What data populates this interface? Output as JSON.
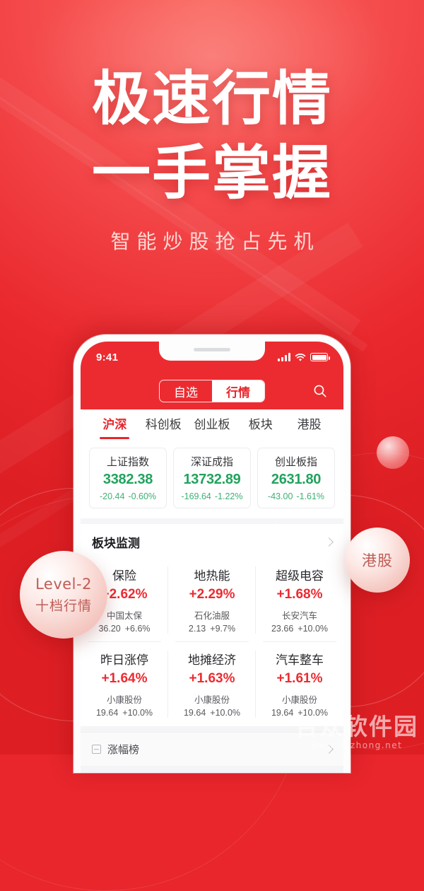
{
  "hero": {
    "line1": "极速行情",
    "line2": "一手掌握",
    "subtitle": "智能炒股抢占先机"
  },
  "badges": {
    "left": {
      "line1": "Level-2",
      "line2": "十档行情"
    },
    "right": {
      "label": "港股"
    }
  },
  "phone": {
    "statusbar": {
      "time": "9:41"
    },
    "navbar": {
      "segments": [
        {
          "label": "自选",
          "active": false
        },
        {
          "label": "行情",
          "active": true
        }
      ],
      "search_icon": "search-icon"
    },
    "tabs": [
      {
        "label": "沪深",
        "active": true
      },
      {
        "label": "科创板",
        "active": false
      },
      {
        "label": "创业板",
        "active": false
      },
      {
        "label": "板块",
        "active": false
      },
      {
        "label": "港股",
        "active": false
      }
    ],
    "indices": [
      {
        "name": "上证指数",
        "value": "3382.38",
        "change": "-20.44",
        "percent": "-0.60%"
      },
      {
        "name": "深证成指",
        "value": "13732.89",
        "change": "-169.64",
        "percent": "-1.22%"
      },
      {
        "name": "创业板指",
        "value": "2631.80",
        "change": "-43.00",
        "percent": "-1.61%"
      }
    ],
    "sector_panel": {
      "title": "板块监测",
      "more_icon": "chevron-right-icon",
      "cells": [
        {
          "sector": "保险",
          "percent": "+2.62%",
          "stock": "中国太保",
          "price": "36.20",
          "stock_percent": "+6.6%"
        },
        {
          "sector": "地热能",
          "percent": "+2.29%",
          "stock": "石化油服",
          "price": "2.13",
          "stock_percent": "+9.7%"
        },
        {
          "sector": "超级电容",
          "percent": "+1.68%",
          "stock": "长安汽车",
          "price": "23.66",
          "stock_percent": "+10.0%"
        },
        {
          "sector": "昨日涨停",
          "percent": "+1.64%",
          "stock": "小康股份",
          "price": "19.64",
          "stock_percent": "+10.0%"
        },
        {
          "sector": "地摊经济",
          "percent": "+1.63%",
          "stock": "小康股份",
          "price": "19.64",
          "stock_percent": "+10.0%"
        },
        {
          "sector": "汽车整车",
          "percent": "+1.61%",
          "stock": "小康股份",
          "price": "19.64",
          "stock_percent": "+10.0%"
        }
      ]
    },
    "footer_row": {
      "icon": "collapse-box-icon",
      "label": "涨幅榜",
      "more_icon": "chevron-right-icon"
    }
  },
  "watermark": {
    "title": "合众软件园",
    "url": "www.hezhong.net"
  },
  "colors": {
    "brand_red": "#e8262c",
    "header_red": "#ec2b31",
    "down_green": "#21a35d",
    "up_red": "#ec2b31",
    "hero_text": "#ffffff",
    "subtitle": "#ffd9d4"
  }
}
